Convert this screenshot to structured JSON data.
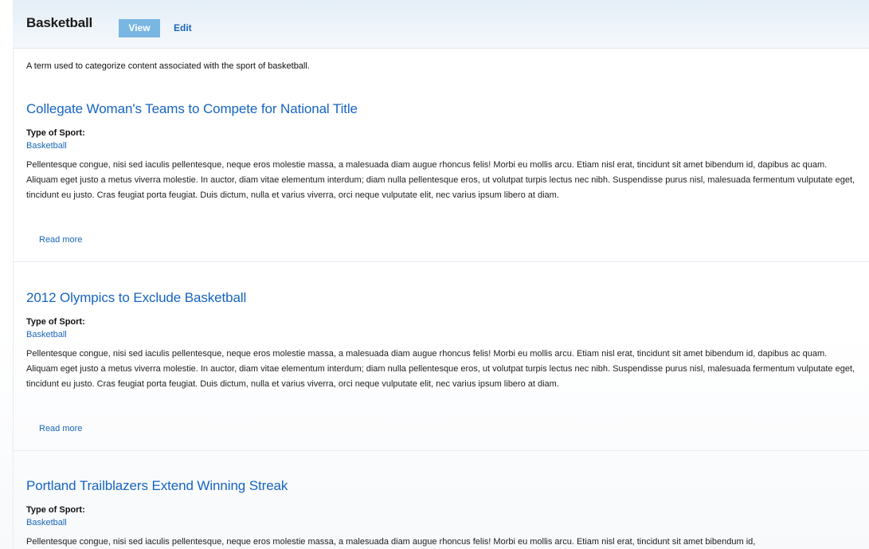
{
  "header": {
    "title": "Basketball",
    "tabs": {
      "view": "View",
      "edit": "Edit"
    }
  },
  "term_description": "A term used to categorize content associated with the sport of basketball.",
  "nodes": [
    {
      "title": "Collegate Woman's Teams to Compete for National Title",
      "field_label": "Type of Sport:",
      "field_value": "Basketball",
      "body": "Pellentesque congue, nisi sed iaculis pellentesque, neque eros molestie massa, a malesuada diam augue rhoncus felis! Morbi eu mollis arcu. Etiam nisl erat, tincidunt sit amet bibendum id, dapibus ac quam. Aliquam eget justo a metus viverra molestie. In auctor, diam vitae elementum interdum; diam nulla pellentesque eros, ut volutpat turpis lectus nec nibh. Suspendisse purus nisl, malesuada fermentum vulputate eget, tincidunt eu justo. Cras feugiat porta feugiat. Duis dictum, nulla et varius viverra, orci neque vulputate elit, nec varius ipsum libero at diam.",
      "read_more": "Read more"
    },
    {
      "title": "2012 Olympics to Exclude Basketball",
      "field_label": "Type of Sport:",
      "field_value": "Basketball",
      "body": "Pellentesque congue, nisi sed iaculis pellentesque, neque eros molestie massa, a malesuada diam augue rhoncus felis! Morbi eu mollis arcu. Etiam nisl erat, tincidunt sit amet bibendum id, dapibus ac quam. Aliquam eget justo a metus viverra molestie. In auctor, diam vitae elementum interdum; diam nulla pellentesque eros, ut volutpat turpis lectus nec nibh. Suspendisse purus nisl, malesuada fermentum vulputate eget, tincidunt eu justo. Cras feugiat porta feugiat. Duis dictum, nulla et varius viverra, orci neque vulputate elit, nec varius ipsum libero at diam.",
      "read_more": "Read more"
    },
    {
      "title": "Portland Trailblazers Extend Winning Streak",
      "field_label": "Type of Sport:",
      "field_value": "Basketball",
      "body": "Pellentesque congue, nisi sed iaculis pellentesque, neque eros molestie massa, a malesuada diam augue rhoncus felis! Morbi eu mollis arcu. Etiam nisl erat, tincidunt sit amet bibendum id,"
    }
  ],
  "colors": {
    "link": "#1a67b8",
    "title_link": "#1664c0",
    "active_tab": "#79b7e3",
    "header_bg": "#e4eef7"
  }
}
